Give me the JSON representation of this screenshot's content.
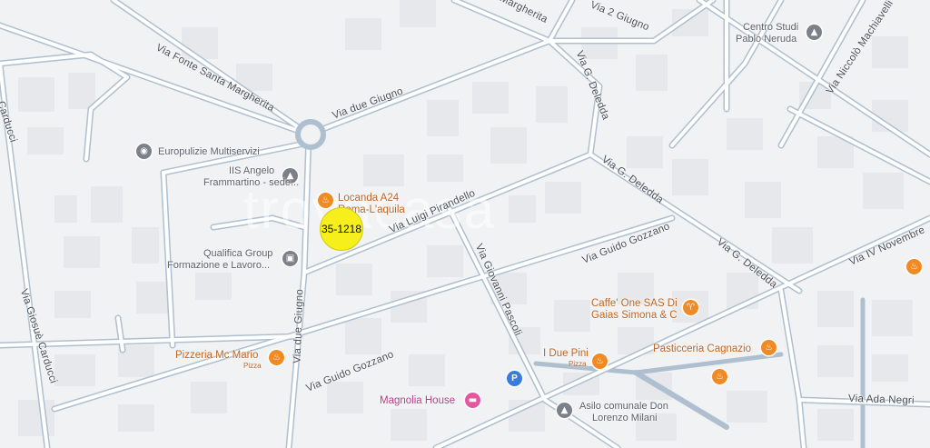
{
  "map": {
    "streets": {
      "fonte_santa_margherita": "Via Fonte Santa Margherita",
      "due_giugno_a": "Via due Giugno",
      "due_giugno_b": "Via due Giugno",
      "due_giugno_top": "Via 2 Giugno",
      "margherita_top": "Margherita",
      "deledda_a": "Via G. Deledda",
      "deledda_b": "Via G. Deledda",
      "deledda_c": "Via G. Deledda",
      "pirandello": "Via Luigi Pirandello",
      "gozzano_a": "Via Guido Gozzano",
      "gozzano_b": "Via Guido Gozzano",
      "pascoli": "Via Giovanni Pascoli",
      "carducci_a": "Via Giosuè Carducci",
      "carducci_b": "Carducci",
      "machiavelli": "Via Niccolò Machiavelli",
      "iv_novembre": "Via IV Novembre",
      "ada_negri": "Via Ada Negri"
    },
    "pois": {
      "europulizie": "Europulizie Multiservizi",
      "iis_line1": "IIS Angelo",
      "iis_line2": "Frammartino - sede...",
      "locanda_line1": "Locanda A24",
      "locanda_line2": "Roma-L'aquila",
      "qualifica_line1": "Qualifica Group",
      "qualifica_line2": "Formazione e Lavoro...",
      "pizzeria_mc_mario": "Pizzeria Mc Mario",
      "pizzeria_mc_mario_sub": "Pizza",
      "centro_studi_line1": "Centro Studi",
      "centro_studi_line2": "Pablo Neruda",
      "caffe_line1": "Caffe' One SAS Di",
      "caffe_line2": "Gaias Simona & C",
      "due_pini": "I Due Pini",
      "due_pini_sub": "Pizza",
      "pasticceria": "Pasticceria Cagnazio",
      "magnolia": "Magnolia House",
      "asilo_line1": "Asilo comunale Don",
      "asilo_line2": "Lorenzo Milani",
      "parking": "P"
    },
    "marker_label": "35-1218",
    "watermark": "trovacasa",
    "colors": {
      "background": "#f1f2f4",
      "road_casing": "#aebfcf",
      "building": "#e6e8ec",
      "marker": "#f7ef1c",
      "food_pin": "#f08a24",
      "hotel_pin": "#e2579e"
    }
  }
}
